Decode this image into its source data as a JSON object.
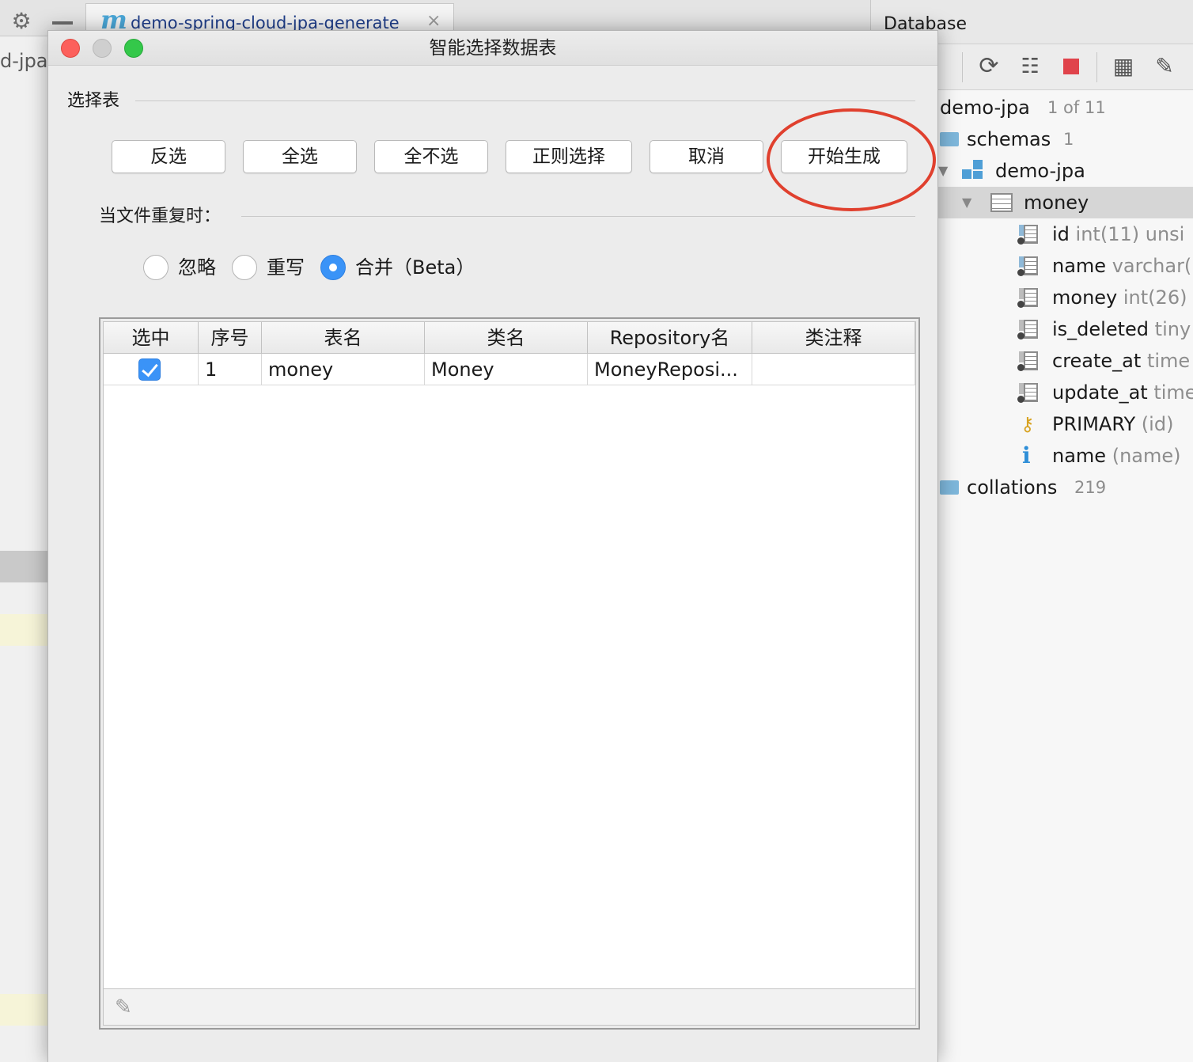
{
  "ide": {
    "gear_icon": "⚙",
    "tab_icon_letter": "m",
    "tab_title": "demo-spring-cloud-jpa-generate",
    "tab_close": "×",
    "left_project_text": "d-jpa"
  },
  "database_panel": {
    "title": "Database",
    "toolbar_icons": [
      "refresh-icon",
      "schema-tools-icon",
      "stop-icon",
      "table-view-icon",
      "edit-icon"
    ],
    "tree": {
      "datasource": {
        "name": "demo-jpa",
        "hint": "1 of 11"
      },
      "schemas": {
        "name": "schemas",
        "hint": "1"
      },
      "schema": {
        "name": "demo-jpa"
      },
      "table": {
        "name": "money"
      },
      "columns": [
        {
          "name": "id",
          "type": "int(11) unsi"
        },
        {
          "name": "name",
          "type": "varchar("
        },
        {
          "name": "money",
          "type": "int(26)"
        },
        {
          "name": "is_deleted",
          "type": "tiny"
        },
        {
          "name": "create_at",
          "type": "time"
        },
        {
          "name": "update_at",
          "type": "time"
        }
      ],
      "primary_key": {
        "name": "PRIMARY",
        "detail": "(id)"
      },
      "index": {
        "name": "name",
        "detail": "(name)"
      },
      "collations": {
        "name": "collations",
        "hint": "219"
      }
    }
  },
  "dialog": {
    "title": "智能选择数据表",
    "select_section_label": "选择表",
    "buttons": {
      "invert": "反选",
      "select_all": "全选",
      "select_none": "全不选",
      "regex_select": "正则选择",
      "cancel": "取消",
      "start_generate": "开始生成"
    },
    "duplicate_section_label": "当文件重复时：",
    "duplicate_options": {
      "ignore": "忽略",
      "overwrite": "重写",
      "merge": "合并（Beta）",
      "selected": "merge"
    },
    "table": {
      "headers": [
        "选中",
        "序号",
        "表名",
        "类名",
        "Repository名",
        "类注释"
      ],
      "rows": [
        {
          "checked": true,
          "index": "1",
          "table_name": "money",
          "class_name": "Money",
          "repository_name": "MoneyReposi...",
          "comment": ""
        }
      ]
    },
    "highlight_color": "#e0402e",
    "accent_color": "#3a93f7"
  }
}
